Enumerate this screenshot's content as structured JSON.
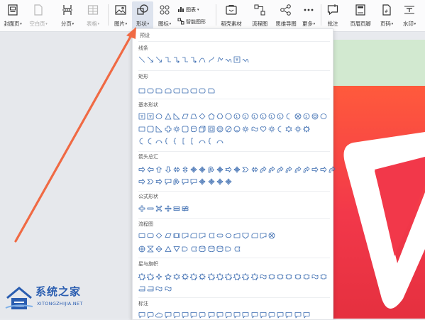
{
  "ribbon": {
    "items": [
      {
        "label": "封面页",
        "caret": true,
        "icon": "cover-page-icon",
        "dim": false
      },
      {
        "label": "空白页",
        "caret": true,
        "icon": "blank-page-icon",
        "dim": true
      },
      {
        "label": "分页",
        "caret": true,
        "icon": "page-break-icon",
        "dim": false
      },
      {
        "label": "表格",
        "caret": true,
        "icon": "table-icon",
        "dim": true
      },
      {
        "label": "图片",
        "caret": true,
        "icon": "picture-icon",
        "dim": false
      },
      {
        "label": "形状",
        "caret": true,
        "icon": "shapes-icon",
        "dim": false,
        "active": true
      },
      {
        "label": "图标",
        "caret": true,
        "icon": "icons-icon",
        "dim": false
      },
      {
        "label": "稻壳素材",
        "caret": false,
        "icon": "docer-material-icon",
        "dim": false
      },
      {
        "label": "流程图",
        "caret": false,
        "icon": "flowchart-icon",
        "dim": false
      },
      {
        "label": "思维导图",
        "caret": false,
        "icon": "mind-map-icon",
        "dim": false
      },
      {
        "label": "更多",
        "caret": true,
        "icon": "more-icon",
        "dim": false
      },
      {
        "label": "批注",
        "caret": false,
        "icon": "comment-icon",
        "dim": false
      },
      {
        "label": "页眉页脚",
        "caret": false,
        "icon": "header-footer-icon",
        "dim": false
      },
      {
        "label": "页码",
        "caret": true,
        "icon": "page-number-icon",
        "dim": false
      },
      {
        "label": "水印",
        "caret": true,
        "icon": "watermark-icon",
        "dim": false
      }
    ],
    "chart_label": "图表",
    "smart_graphic_label": "智能图形"
  },
  "panel": {
    "preset_label": "预设",
    "sections": [
      {
        "title": "线条"
      },
      {
        "title": "矩形"
      },
      {
        "title": "基本形状"
      },
      {
        "title": "箭头总汇"
      },
      {
        "title": "公式形状"
      },
      {
        "title": "流程图"
      },
      {
        "title": "星与旗帜"
      },
      {
        "title": "标注"
      }
    ]
  },
  "watermark": {
    "brand": "系统之家",
    "url": "XITONGZHIJIA.NET"
  },
  "colors": {
    "accent_arrow": "#f06a44",
    "shape_stroke": "#3a6bb0",
    "art_red": "#f2384a",
    "band_green": "#d2e9d0"
  }
}
